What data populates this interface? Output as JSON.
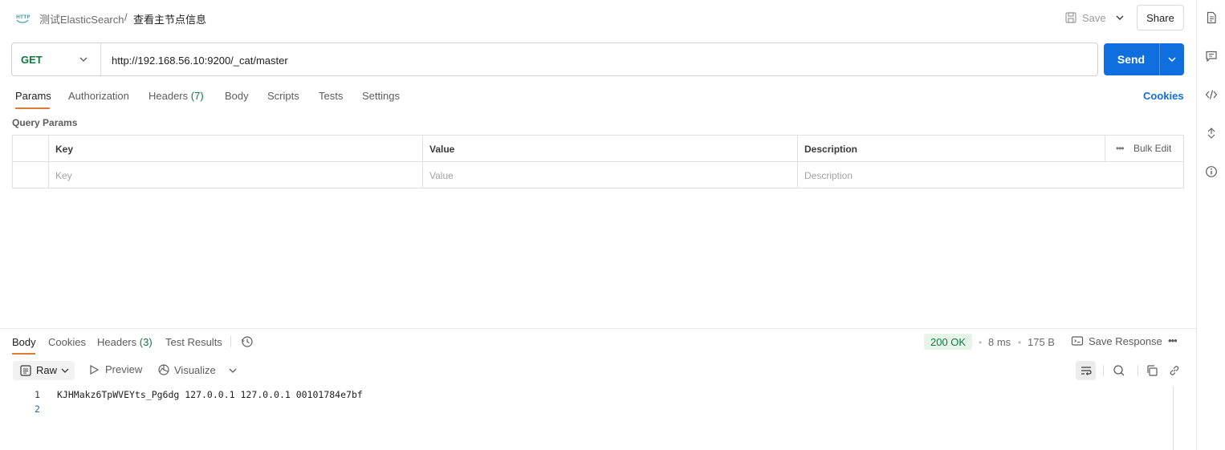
{
  "header": {
    "collection": "测试ElasticSearch",
    "separator": "/",
    "request_name": "查看主节点信息",
    "save_label": "Save",
    "share_label": "Share"
  },
  "request": {
    "method": "GET",
    "url": "http://192.168.56.10:9200/_cat/master",
    "send_label": "Send"
  },
  "request_tabs": [
    {
      "label": "Params",
      "count": ""
    },
    {
      "label": "Authorization",
      "count": ""
    },
    {
      "label": "Headers",
      "count": "(7)"
    },
    {
      "label": "Body",
      "count": ""
    },
    {
      "label": "Scripts",
      "count": ""
    },
    {
      "label": "Tests",
      "count": ""
    },
    {
      "label": "Settings",
      "count": ""
    }
  ],
  "cookies_link": "Cookies",
  "query_params": {
    "title": "Query Params",
    "headers": {
      "key": "Key",
      "value": "Value",
      "description": "Description"
    },
    "bulk_edit": "Bulk Edit",
    "placeholders": {
      "key": "Key",
      "value": "Value",
      "description": "Description"
    }
  },
  "response": {
    "tabs": [
      {
        "label": "Body",
        "count": ""
      },
      {
        "label": "Cookies",
        "count": ""
      },
      {
        "label": "Headers",
        "count": "(3)"
      },
      {
        "label": "Test Results",
        "count": ""
      }
    ],
    "status": "200 OK",
    "time": "8 ms",
    "size": "175 B",
    "save_response": "Save Response",
    "format_label": "Raw",
    "preview_label": "Preview",
    "visualize_label": "Visualize",
    "lines": [
      {
        "number": "1",
        "text": "KJHMakz6TpWVEYts_Pg6dg 127.0.0.1 127.0.0.1 00101784e7bf"
      },
      {
        "number": "2",
        "text": ""
      }
    ]
  },
  "colors": {
    "accent": "#0f6fde",
    "method_green": "#0b7a3e",
    "tab_underline": "#e07a2f",
    "status_bg": "#e6f4ea"
  },
  "icons": [
    "http-icon",
    "save-icon",
    "chevron-down-icon",
    "history-icon",
    "save-response-icon",
    "raw-icon",
    "preview-icon",
    "visualize-icon",
    "wrap-icon",
    "search-icon",
    "copy-icon",
    "link-icon",
    "docs-icon",
    "comments-icon",
    "code-icon",
    "related-icon",
    "info-icon"
  ]
}
